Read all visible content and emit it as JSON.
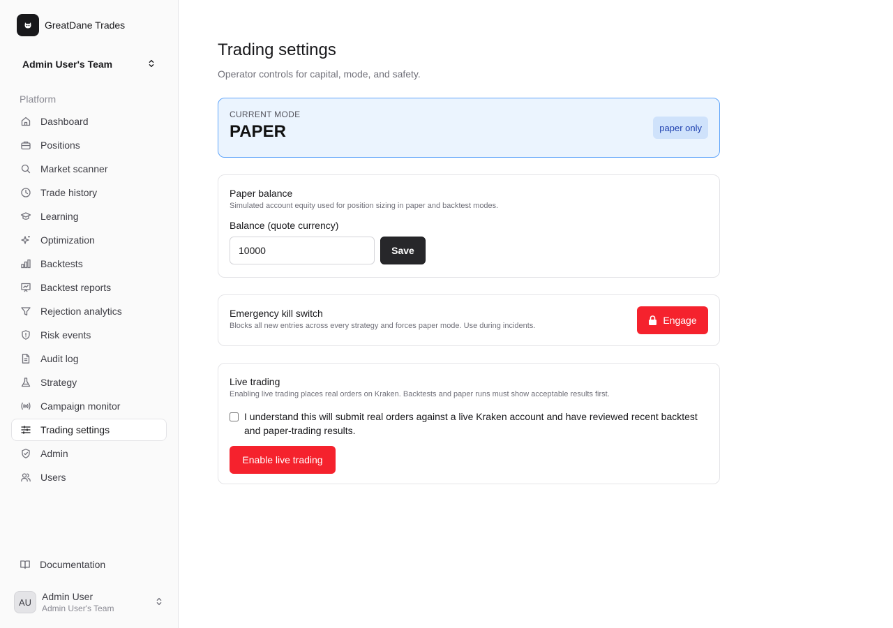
{
  "brand": {
    "name": "GreatDane Trades"
  },
  "team": {
    "name": "Admin User's Team"
  },
  "sidebar": {
    "group_label": "Platform",
    "items": [
      {
        "label": "Dashboard",
        "icon": "home-icon"
      },
      {
        "label": "Positions",
        "icon": "briefcase-icon"
      },
      {
        "label": "Market scanner",
        "icon": "search-icon"
      },
      {
        "label": "Trade history",
        "icon": "clock-icon"
      },
      {
        "label": "Learning",
        "icon": "graduation-cap-icon"
      },
      {
        "label": "Optimization",
        "icon": "sparkles-icon"
      },
      {
        "label": "Backtests",
        "icon": "bar-chart-icon"
      },
      {
        "label": "Backtest reports",
        "icon": "presentation-chart-icon"
      },
      {
        "label": "Rejection analytics",
        "icon": "funnel-icon"
      },
      {
        "label": "Risk events",
        "icon": "shield-alert-icon"
      },
      {
        "label": "Audit log",
        "icon": "file-text-icon"
      },
      {
        "label": "Strategy",
        "icon": "flask-icon"
      },
      {
        "label": "Campaign monitor",
        "icon": "radio-icon"
      },
      {
        "label": "Trading settings",
        "icon": "sliders-icon",
        "active": true
      },
      {
        "label": "Admin",
        "icon": "shield-check-icon"
      },
      {
        "label": "Users",
        "icon": "users-icon"
      }
    ],
    "docs_label": "Documentation"
  },
  "user": {
    "initials": "AU",
    "name": "Admin User",
    "team": "Admin User's Team"
  },
  "page": {
    "title": "Trading settings",
    "subtitle": "Operator controls for capital, mode, and safety."
  },
  "mode": {
    "label": "CURRENT MODE",
    "value": "PAPER",
    "badge": "paper only"
  },
  "paper_balance": {
    "title": "Paper balance",
    "description": "Simulated account equity used for position sizing in paper and backtest modes.",
    "field_label": "Balance (quote currency)",
    "value": "10000",
    "save_label": "Save"
  },
  "kill_switch": {
    "title": "Emergency kill switch",
    "description": "Blocks all new entries across every strategy and forces paper mode. Use during incidents.",
    "button_label": "Engage"
  },
  "live_trading": {
    "title": "Live trading",
    "description": "Enabling live trading places real orders on Kraken. Backtests and paper runs must show acceptable results first.",
    "checkbox_label": "I understand this will submit real orders against a live Kraken account and have reviewed recent backtest and paper-trading results.",
    "button_label": "Enable live trading"
  },
  "colors": {
    "accent_red": "#f5222d",
    "mode_bg": "#ebf4fe",
    "mode_border": "#60a5fa",
    "dark_button": "#27272a"
  }
}
